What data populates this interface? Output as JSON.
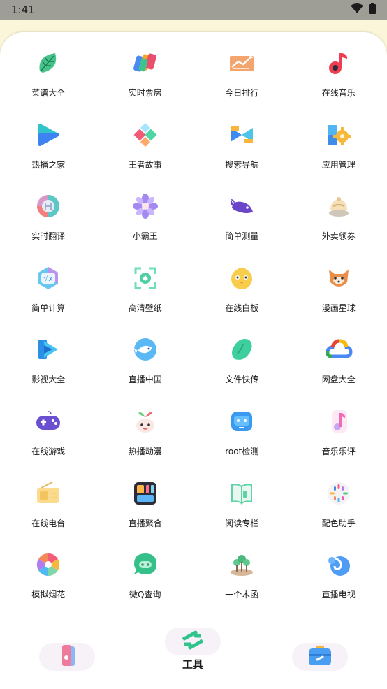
{
  "status_bar": {
    "time": "1:41",
    "icons": [
      "wifi-icon",
      "battery-icon"
    ]
  },
  "apps": [
    {
      "label": "菜谱大全",
      "icon": "leaf-icon"
    },
    {
      "label": "实时票房",
      "icon": "ticket-cards-icon"
    },
    {
      "label": "今日排行",
      "icon": "trending-chart-icon"
    },
    {
      "label": "在线音乐",
      "icon": "music-note-icon"
    },
    {
      "label": "热播之家",
      "icon": "play-icon"
    },
    {
      "label": "王者故事",
      "icon": "diamonds-icon"
    },
    {
      "label": "搜索导航",
      "icon": "bowtie-icon"
    },
    {
      "label": "应用管理",
      "icon": "gear-puzzle-icon"
    },
    {
      "label": "实时翻译",
      "icon": "translate-icon"
    },
    {
      "label": "小霸王",
      "icon": "pinwheel-icon"
    },
    {
      "label": "简单测量",
      "icon": "whale-icon"
    },
    {
      "label": "外卖领券",
      "icon": "food-icon"
    },
    {
      "label": "简单计算",
      "icon": "sqrt-icon"
    },
    {
      "label": "高清壁纸",
      "icon": "scan-frame-icon"
    },
    {
      "label": "在线白板",
      "icon": "chick-icon"
    },
    {
      "label": "漫画星球",
      "icon": "fox-icon"
    },
    {
      "label": "影视大全",
      "icon": "video-play-icon"
    },
    {
      "label": "直播中国",
      "icon": "fish-icon"
    },
    {
      "label": "文件快传",
      "icon": "bean-icon"
    },
    {
      "label": "网盘大全",
      "icon": "cloud-icon"
    },
    {
      "label": "在线游戏",
      "icon": "gamepad-icon"
    },
    {
      "label": "热播动漫",
      "icon": "sprout-face-icon"
    },
    {
      "label": "root检测",
      "icon": "robot-face-icon"
    },
    {
      "label": "音乐乐评",
      "icon": "music-card-icon"
    },
    {
      "label": "在线电台",
      "icon": "radio-icon"
    },
    {
      "label": "直播聚合",
      "icon": "tiles-icon"
    },
    {
      "label": "阅读专栏",
      "icon": "book-icon"
    },
    {
      "label": "配色助手",
      "icon": "palette-dots-icon"
    },
    {
      "label": "模拟烟花",
      "icon": "fireworks-icon"
    },
    {
      "label": "微Q查询",
      "icon": "chat-bubble-icon"
    },
    {
      "label": "一个木函",
      "icon": "trees-icon"
    },
    {
      "label": "直播电视",
      "icon": "swirl-icon"
    }
  ],
  "bottom_nav": {
    "left_icon": "cards-icon",
    "center_icon": "swap-arrows-icon",
    "center_label": "工具",
    "right_icon": "toolbox-icon"
  }
}
